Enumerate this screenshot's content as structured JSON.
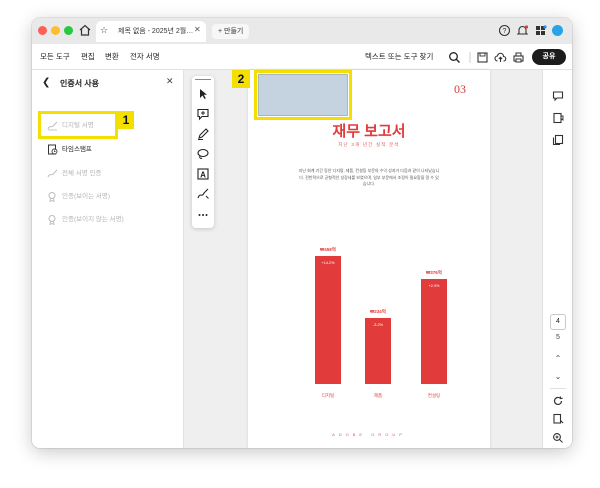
{
  "browser": {
    "tab_title": "제목 없음 - 2025년 2월…",
    "new_tab_label": "+ 만들기"
  },
  "menu": {
    "items": [
      "모든 도구",
      "편집",
      "변환",
      "전자 서명"
    ],
    "search_label": "텍스트 또는 도구 찾기",
    "share_label": "공유"
  },
  "panel": {
    "title": "인증서 사용",
    "items": [
      {
        "label": "디지털 서명",
        "state": "disabled",
        "icon": "signature-icon"
      },
      {
        "label": "타임스탬프",
        "state": "active",
        "icon": "timestamp-icon"
      },
      {
        "label": "전체 서명 인증",
        "state": "disabled",
        "icon": "certify-icon"
      },
      {
        "label": "인증(보이는 서명)",
        "state": "disabled",
        "icon": "certify-visible-icon"
      },
      {
        "label": "인증(보이지 않는 서명)",
        "state": "disabled",
        "icon": "certify-invisible-icon"
      }
    ]
  },
  "annotations": {
    "badge1": "1",
    "badge2": "2",
    "highlight_color": "#f3e000"
  },
  "document": {
    "page_number": "03",
    "title": "재무 보고서",
    "subtitle": "지난 3개 년간 실적 분석",
    "body": "지난 회계 기간 동안 디지털, 제품, 컨설팅 부문의 수익 성과가 다음과 같이 나타났습니다. 전반적으로 균형적인 성장세를 보였으며, 일부 부문에서 조정이 필요함을 알 수 있습니다.",
    "footer": "ADOBE GROUP",
    "accent_color": "#e23b3b"
  },
  "chart_data": {
    "type": "bar",
    "categories": [
      "디지털",
      "제품",
      "컨설팅"
    ],
    "values": [
      458,
      234,
      376
    ],
    "value_labels": [
      "₩458억",
      "₩234억",
      "₩376억"
    ],
    "change_labels": [
      "+14.2%",
      "-3.2%",
      "+2.9%"
    ],
    "ylim": [
      0,
      500
    ]
  },
  "rail": {
    "current_page": "4",
    "total_pages": "5"
  }
}
